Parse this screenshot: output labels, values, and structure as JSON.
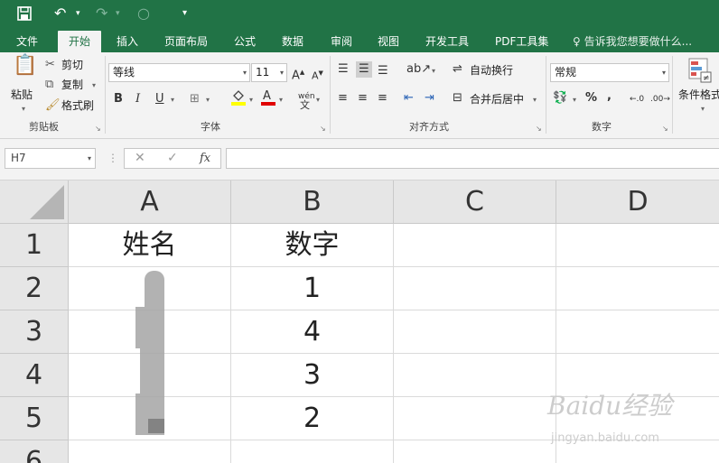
{
  "quick_access": {
    "save_icon": "save-icon",
    "undo_icon": "undo-icon",
    "redo_icon": "redo-icon",
    "touch_icon": "touch-mode-icon",
    "customize_icon": "customize-icon"
  },
  "tabs": [
    {
      "label": "文件"
    },
    {
      "label": "开始"
    },
    {
      "label": "插入"
    },
    {
      "label": "页面布局"
    },
    {
      "label": "公式"
    },
    {
      "label": "数据"
    },
    {
      "label": "审阅"
    },
    {
      "label": "视图"
    },
    {
      "label": "开发工具"
    },
    {
      "label": "PDF工具集"
    }
  ],
  "tell_me": "告诉我您想要做什么...",
  "ribbon": {
    "clipboard": {
      "paste": "粘贴",
      "cut": "剪切",
      "copy": "复制",
      "format_painter": "格式刷",
      "group_label": "剪贴板"
    },
    "font": {
      "font_name": "等线",
      "font_size": "11",
      "bold": "B",
      "italic": "I",
      "underline": "U",
      "phonetic": "wén",
      "group_label": "字体"
    },
    "alignment": {
      "wrap_text": "自动换行",
      "merge_center": "合并后居中",
      "group_label": "对齐方式"
    },
    "number": {
      "format": "常规",
      "percent": "%",
      "comma": ",",
      "group_label": "数字"
    },
    "styles": {
      "conditional_format": "条件格式"
    }
  },
  "formula_bar": {
    "name_box": "H7",
    "cancel": "✕",
    "enter": "✓",
    "fx": "fx",
    "formula": ""
  },
  "sheet": {
    "columns": [
      "A",
      "B",
      "C",
      "D"
    ],
    "rows": [
      "1",
      "2",
      "3",
      "4",
      "5",
      "6"
    ],
    "cells": {
      "A1": "姓名",
      "B1": "数字",
      "B2": "1",
      "B3": "4",
      "B4": "3",
      "B5": "2"
    }
  },
  "watermark": {
    "brand": "Baidu经验",
    "url": "jingyan.baidu.com"
  }
}
